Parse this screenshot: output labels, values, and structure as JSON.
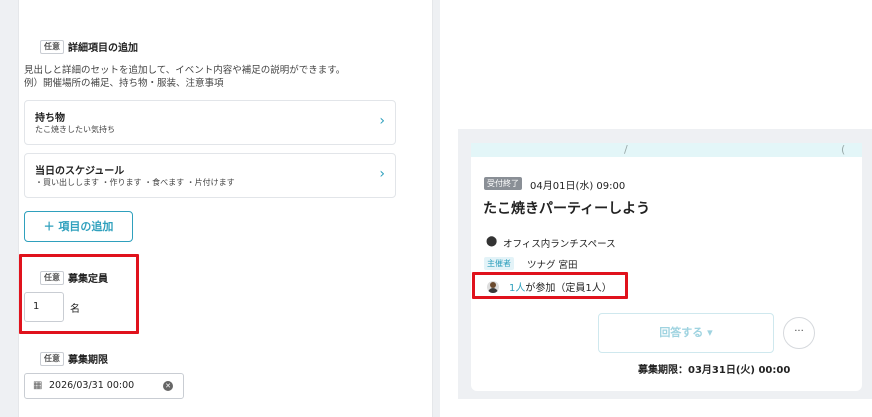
{
  "form": {
    "details": {
      "tag": "任意",
      "title": "詳細項目の追加",
      "description_line1": "見出しと詳細のセットを追加して、イベント内容や補足の説明ができます。",
      "description_line2": "例）開催場所の補足、持ち物・服装、注意事項",
      "items": [
        {
          "title": "持ち物",
          "subtitle": "たこ焼きしたい気持ち"
        },
        {
          "title": "当日のスケジュール",
          "subtitle": "・買い出しします ・作ります ・食べます ・片付けます"
        }
      ],
      "add_button": "＋ 項目の追加"
    },
    "capacity": {
      "tag": "任意",
      "title": "募集定員",
      "value": "1",
      "unit": "名"
    },
    "deadline": {
      "tag": "任意",
      "title": "募集期限",
      "value": "2026/03/31 00:00"
    }
  },
  "event": {
    "status_badge": "受付終了",
    "datetime": "04月01日(水) 09:00",
    "title": "たこ焼きパーティーしよう",
    "location": "オフィス内ランチスペース",
    "host_badge": "主催者",
    "host_name": "ツナグ 宮田",
    "participants_link": "1人",
    "participants_rest": "が参加（定員1人）",
    "answer_button": "回答する ▾",
    "more_button": "···",
    "deadline": "募集期限：03月31日(火) 00:00"
  },
  "colors": {
    "accent": "#2fa0bd",
    "highlight_box": "#e0121c",
    "closed_badge": "#8a8f96"
  },
  "icons": [
    "chevron-right-icon",
    "calendar-icon",
    "clear-icon",
    "location-pin-icon",
    "avatar",
    "chevron-down-icon"
  ]
}
